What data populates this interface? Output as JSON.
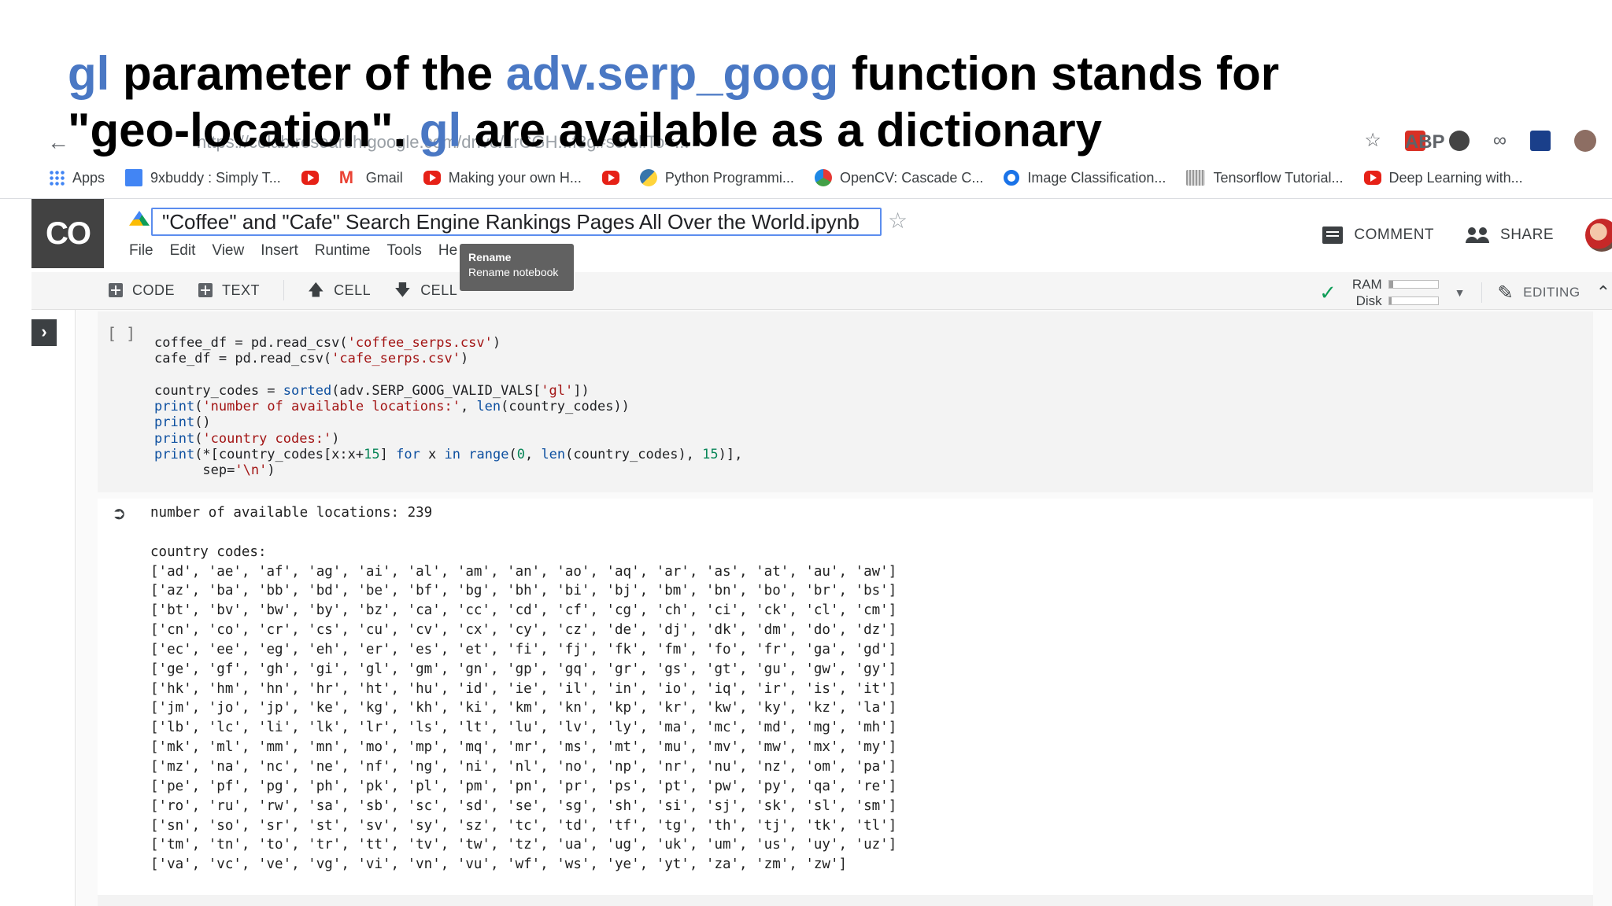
{
  "slide": {
    "title_parts": [
      {
        "text": "gl",
        "highlight": true
      },
      {
        "text": " parameter of the ",
        "highlight": false
      },
      {
        "text": "adv.serp_goog",
        "highlight": true
      },
      {
        "text": " function stands for",
        "highlight": false
      }
    ],
    "title_parts_2": [
      {
        "text": "\"geo-location\". ",
        "highlight": false
      },
      {
        "text": "gl",
        "highlight": true
      },
      {
        "text": " are available as a dictionary",
        "highlight": false
      }
    ],
    "highlight_color": "#4a78c4"
  },
  "browser": {
    "back_icon": "arrow-left-icon",
    "url": "https://colab.research.google.com/drive/1rCGH...f8g#scrollTo=...",
    "bookmarks": [
      {
        "label": "Apps",
        "icon": "apps-grid-icon"
      },
      {
        "label": "9xbuddy : Simply T...",
        "icon": "doc-icon"
      },
      {
        "label": "",
        "icon": "youtube-icon"
      },
      {
        "label": "Gmail",
        "icon": "gmail-icon"
      },
      {
        "label": "Making your own H...",
        "icon": "youtube-icon"
      },
      {
        "label": "",
        "icon": "youtube-icon"
      },
      {
        "label": "Python Programmi...",
        "icon": "python-icon"
      },
      {
        "label": "OpenCV: Cascade C...",
        "icon": "opencv-icon"
      },
      {
        "label": "Image Classification...",
        "icon": "circle-icon"
      },
      {
        "label": "Tensorflow Tutorial...",
        "icon": "tensorflow-icon"
      },
      {
        "label": "Deep Learning with...",
        "icon": "youtube-icon"
      }
    ]
  },
  "colab": {
    "logo": "CO",
    "notebook_title": "\"Coffee\" and \"Cafe\" Search Engine Rankings Pages All Over the World.ipynb",
    "menu": [
      "File",
      "Edit",
      "View",
      "Insert",
      "Runtime",
      "Tools",
      "He"
    ],
    "tooltip": {
      "title": "Rename",
      "subtitle": "Rename notebook"
    },
    "comment_label": "COMMENT",
    "share_label": "SHARE",
    "toolbar": {
      "code_label": "CODE",
      "text_label": "TEXT",
      "cell_up_label": "CELL",
      "cell_down_label": "CELL",
      "ram_label": "RAM",
      "disk_label": "Disk",
      "ram_fill_pct": 8,
      "disk_fill_pct": 5,
      "editing_label": "EDITING"
    }
  },
  "cell": {
    "bracket": "[ ]",
    "code_lines": [
      [
        {
          "t": "coffee_df = pd.read_csv("
        },
        {
          "t": "'coffee_serps.csv'",
          "c": "str"
        },
        {
          "t": ")"
        }
      ],
      [
        {
          "t": "cafe_df = pd.read_csv("
        },
        {
          "t": "'cafe_serps.csv'",
          "c": "str"
        },
        {
          "t": ")"
        }
      ],
      [
        {
          "t": ""
        }
      ],
      [
        {
          "t": "country_codes = "
        },
        {
          "t": "sorted",
          "c": "fn"
        },
        {
          "t": "(adv.SERP_GOOG_VALID_VALS["
        },
        {
          "t": "'gl'",
          "c": "str"
        },
        {
          "t": "])"
        }
      ],
      [
        {
          "t": "print",
          "c": "fn"
        },
        {
          "t": "("
        },
        {
          "t": "'number of available locations:'",
          "c": "str"
        },
        {
          "t": ", "
        },
        {
          "t": "len",
          "c": "fn"
        },
        {
          "t": "(country_codes))"
        }
      ],
      [
        {
          "t": "print",
          "c": "fn"
        },
        {
          "t": "()"
        }
      ],
      [
        {
          "t": "print",
          "c": "fn"
        },
        {
          "t": "("
        },
        {
          "t": "'country codes:'",
          "c": "str"
        },
        {
          "t": ")"
        }
      ],
      [
        {
          "t": "print",
          "c": "fn"
        },
        {
          "t": "(*[country_codes[x:x+"
        },
        {
          "t": "15",
          "c": "num"
        },
        {
          "t": "] "
        },
        {
          "t": "for",
          "c": "kw"
        },
        {
          "t": " x "
        },
        {
          "t": "in",
          "c": "kw"
        },
        {
          "t": " "
        },
        {
          "t": "range",
          "c": "fn"
        },
        {
          "t": "("
        },
        {
          "t": "0",
          "c": "num"
        },
        {
          "t": ", "
        },
        {
          "t": "len",
          "c": "fn"
        },
        {
          "t": "(country_codes), "
        },
        {
          "t": "15",
          "c": "num"
        },
        {
          "t": ")],"
        }
      ],
      [
        {
          "t": "      sep="
        },
        {
          "t": "'\\n'",
          "c": "str"
        },
        {
          "t": ")"
        }
      ]
    ]
  },
  "output": {
    "lines": [
      "number of available locations: 239",
      "",
      "country codes:",
      "['ad', 'ae', 'af', 'ag', 'ai', 'al', 'am', 'an', 'ao', 'aq', 'ar', 'as', 'at', 'au', 'aw']",
      "['az', 'ba', 'bb', 'bd', 'be', 'bf', 'bg', 'bh', 'bi', 'bj', 'bm', 'bn', 'bo', 'br', 'bs']",
      "['bt', 'bv', 'bw', 'by', 'bz', 'ca', 'cc', 'cd', 'cf', 'cg', 'ch', 'ci', 'ck', 'cl', 'cm']",
      "['cn', 'co', 'cr', 'cs', 'cu', 'cv', 'cx', 'cy', 'cz', 'de', 'dj', 'dk', 'dm', 'do', 'dz']",
      "['ec', 'ee', 'eg', 'eh', 'er', 'es', 'et', 'fi', 'fj', 'fk', 'fm', 'fo', 'fr', 'ga', 'gd']",
      "['ge', 'gf', 'gh', 'gi', 'gl', 'gm', 'gn', 'gp', 'gq', 'gr', 'gs', 'gt', 'gu', 'gw', 'gy']",
      "['hk', 'hm', 'hn', 'hr', 'ht', 'hu', 'id', 'ie', 'il', 'in', 'io', 'iq', 'ir', 'is', 'it']",
      "['jm', 'jo', 'jp', 'ke', 'kg', 'kh', 'ki', 'km', 'kn', 'kp', 'kr', 'kw', 'ky', 'kz', 'la']",
      "['lb', 'lc', 'li', 'lk', 'lr', 'ls', 'lt', 'lu', 'lv', 'ly', 'ma', 'mc', 'md', 'mg', 'mh']",
      "['mk', 'ml', 'mm', 'mn', 'mo', 'mp', 'mq', 'mr', 'ms', 'mt', 'mu', 'mv', 'mw', 'mx', 'my']",
      "['mz', 'na', 'nc', 'ne', 'nf', 'ng', 'ni', 'nl', 'no', 'np', 'nr', 'nu', 'nz', 'om', 'pa']",
      "['pe', 'pf', 'pg', 'ph', 'pk', 'pl', 'pm', 'pn', 'pr', 'ps', 'pt', 'pw', 'py', 'qa', 're']",
      "['ro', 'ru', 'rw', 'sa', 'sb', 'sc', 'sd', 'se', 'sg', 'sh', 'si', 'sj', 'sk', 'sl', 'sm']",
      "['sn', 'so', 'sr', 'st', 'sv', 'sy', 'sz', 'tc', 'td', 'tf', 'tg', 'th', 'tj', 'tk', 'tl']",
      "['tm', 'tn', 'to', 'tr', 'tt', 'tv', 'tw', 'tz', 'ua', 'ug', 'uk', 'um', 'us', 'uy', 'uz']",
      "['va', 'vc', 've', 'vg', 'vi', 'vn', 'vu', 'wf', 'ws', 'ye', 'yt', 'za', 'zm', 'zw']"
    ]
  }
}
